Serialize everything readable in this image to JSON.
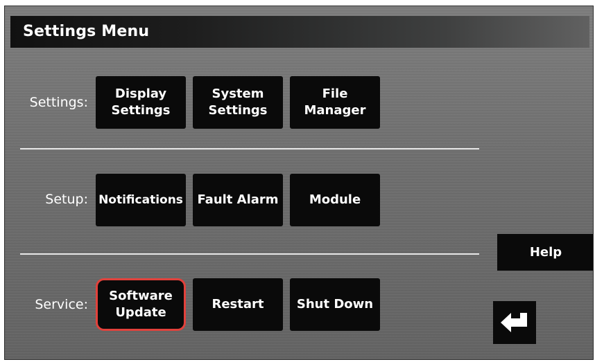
{
  "header": {
    "title": "Settings Menu"
  },
  "rows": {
    "settings": {
      "label": "Settings:",
      "buttons": [
        "Display\nSettings",
        "System\nSettings",
        "File\nManager"
      ]
    },
    "setup": {
      "label": "Setup:",
      "buttons": [
        "Notifications",
        "Fault Alarm",
        "Module"
      ]
    },
    "service": {
      "label": "Service:",
      "buttons": [
        "Software\nUpdate",
        "Restart",
        "Shut Down"
      ]
    }
  },
  "side": {
    "help_label": "Help",
    "back_icon": "return-arrow-icon"
  },
  "colors": {
    "selected_outline": "#e2413b",
    "button_bg": "#0a0a0a",
    "panel_bg": "#6e6e6e"
  }
}
